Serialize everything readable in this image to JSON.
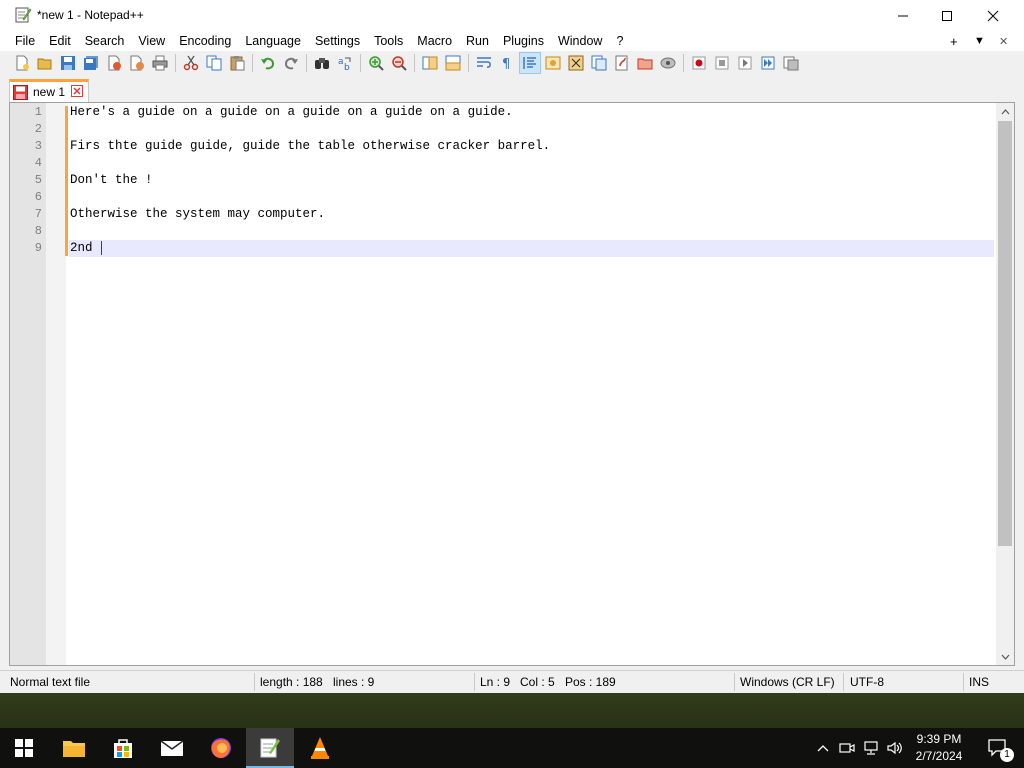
{
  "window": {
    "title": "*new 1 - Notepad++",
    "controls": {
      "minimize": "minimize",
      "maximize": "maximize",
      "close": "close"
    }
  },
  "menubar": {
    "items": [
      "File",
      "Edit",
      "Search",
      "View",
      "Encoding",
      "Language",
      "Settings",
      "Tools",
      "Macro",
      "Run",
      "Plugins",
      "Window",
      "?"
    ],
    "right": {
      "plus": "+",
      "dropdown": "▼",
      "close": "✕"
    }
  },
  "toolbar": {
    "buttons": [
      "new-file",
      "open-file",
      "save",
      "save-all",
      "close",
      "close-all",
      "print",
      "cut",
      "copy",
      "paste",
      "undo",
      "redo",
      "find",
      "replace",
      "zoom-in",
      "zoom-out",
      "sync-vertical",
      "sync-horizontal",
      "word-wrap",
      "show-all-chars",
      "indent-guide",
      "user-defined-language",
      "document-map",
      "function-list",
      "folder-as-workspace",
      "monitoring",
      "record-macro",
      "stop-recording",
      "playback-macro",
      "run-macro-multiple",
      "save-macro"
    ]
  },
  "tabs": [
    {
      "label": "new 1",
      "modified": true
    }
  ],
  "editor": {
    "lines": [
      {
        "num": "1",
        "text": "Here's a guide on a guide on a guide on a guide on a guide."
      },
      {
        "num": "2",
        "text": ""
      },
      {
        "num": "3",
        "text": "Firs thte guide guide, guide the table otherwise cracker barrel."
      },
      {
        "num": "4",
        "text": ""
      },
      {
        "num": "5",
        "text": "Don't the !"
      },
      {
        "num": "6",
        "text": ""
      },
      {
        "num": "7",
        "text": "Otherwise the system may computer."
      },
      {
        "num": "8",
        "text": ""
      },
      {
        "num": "9",
        "text": "2nd "
      }
    ],
    "current_line": 9
  },
  "statusbar": {
    "file_type": "Normal text file",
    "length": "length : 188",
    "lines": "lines : 9",
    "ln": "Ln : 9",
    "col": "Col : 5",
    "pos": "Pos : 189",
    "eol": "Windows (CR LF)",
    "encoding": "UTF-8",
    "mode": "INS"
  },
  "taskbar": {
    "apps": [
      "start",
      "file-explorer",
      "microsoft-store",
      "mail",
      "firefox",
      "notepad-plus-plus",
      "vlc"
    ],
    "time": "9:39 PM",
    "date": "2/7/2024",
    "notification_count": "1"
  }
}
